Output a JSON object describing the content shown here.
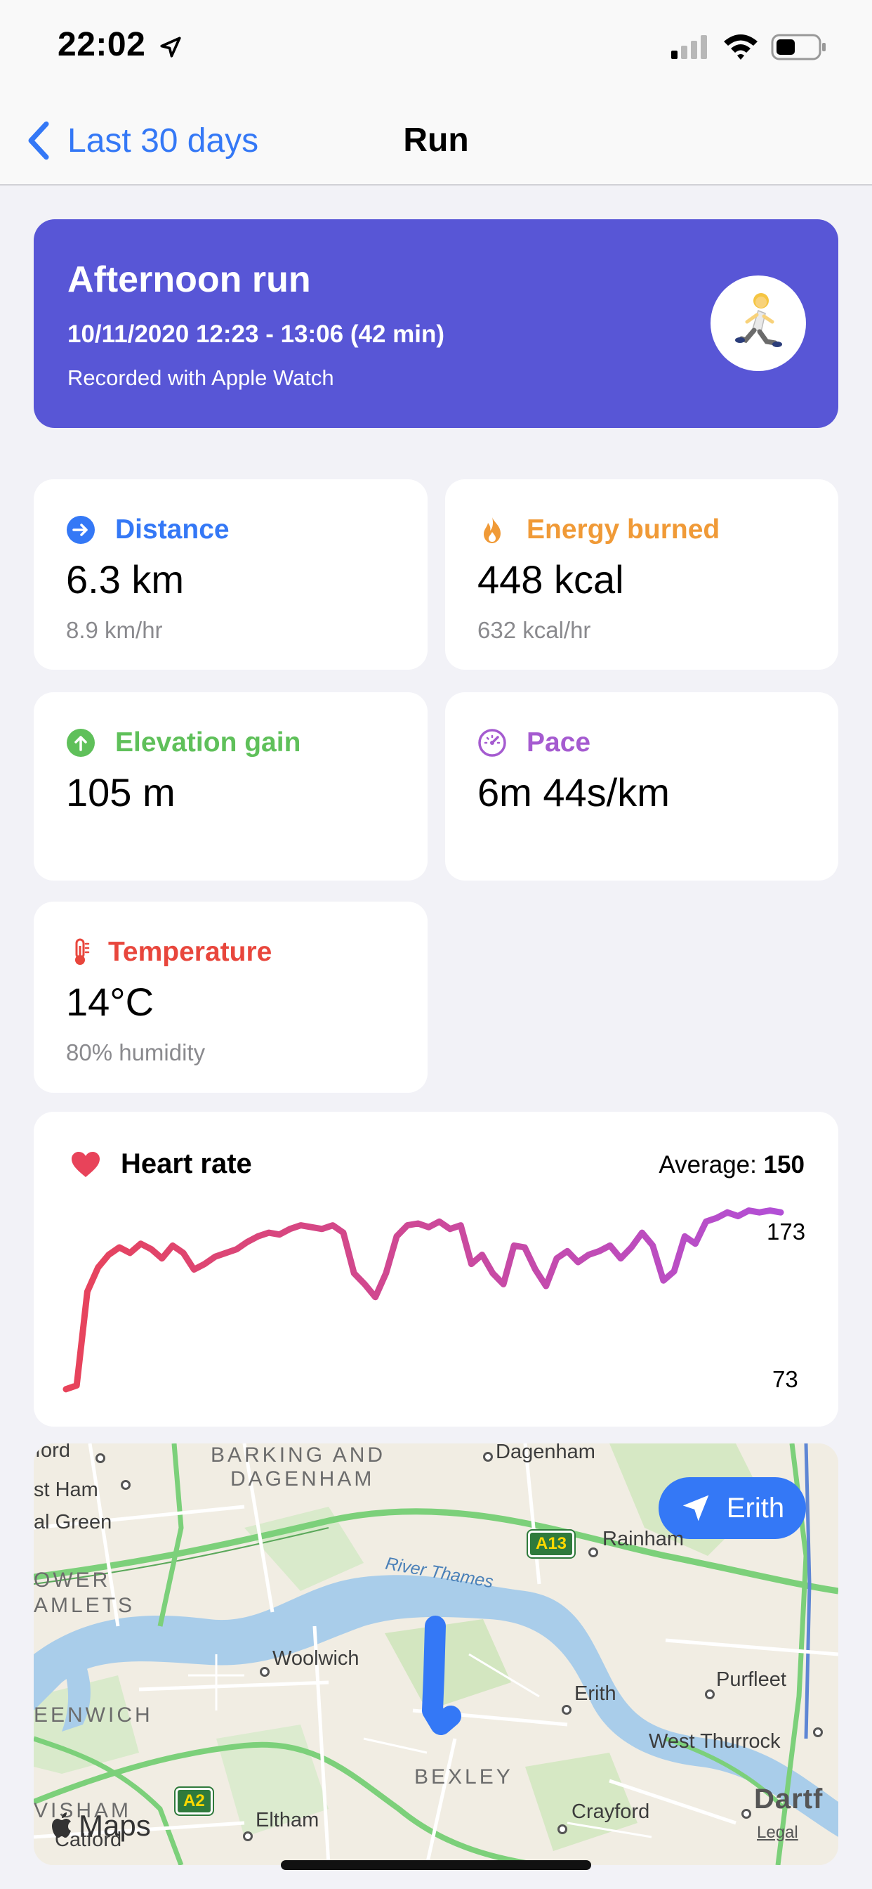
{
  "status_bar": {
    "time": "22:02"
  },
  "nav": {
    "back_label": "Last 30 days",
    "title": "Run"
  },
  "workout": {
    "title": "Afternoon run",
    "time_range": "10/11/2020 12:23 - 13:06 (42 min)",
    "source": "Recorded with Apple Watch",
    "icon": "runner-emoji"
  },
  "metrics": {
    "distance": {
      "label": "Distance",
      "value": "6.3 km",
      "sub": "8.9 km/hr",
      "color": "#3478f6",
      "icon": "arrow-right-circle-icon"
    },
    "energy": {
      "label": "Energy burned",
      "value": "448 kcal",
      "sub": "632 kcal/hr",
      "color": "#f09a37",
      "icon": "flame-icon"
    },
    "elevation": {
      "label": "Elevation gain",
      "value": "105 m",
      "color": "#5fc05a",
      "icon": "arrow-up-circle-icon"
    },
    "pace": {
      "label": "Pace",
      "value": "6m 44s/km",
      "color": "#a55bd0",
      "icon": "speedometer-icon"
    },
    "temperature": {
      "label": "Temperature",
      "value": "14°C",
      "sub": "80% humidity",
      "color": "#e8463c",
      "icon": "thermometer-icon"
    }
  },
  "heart_rate": {
    "title": "Heart rate",
    "average_label": "Average:",
    "average_value": "150",
    "max_label": "173",
    "min_label": "73",
    "colors": {
      "start": "#e8435a",
      "end": "#b24fd6"
    }
  },
  "map": {
    "location_button": "Erith",
    "labels": {
      "ilford": "ford",
      "east_ham": "st Ham",
      "plaistow_green": "al Green",
      "barking": "BARKING AND",
      "dagenham_area": "DAGENHAM",
      "dagenham": "Dagenham",
      "rainham": "Rainham",
      "tower": "OWER",
      "hamlets": "AMLETS",
      "river": "River Thames",
      "woolwich": "Woolwich",
      "erith": "Erith",
      "purfleet": "Purfleet",
      "greenwich": "EENWICH",
      "west_thurrock": "West Thurrock",
      "bexley": "BEXLEY",
      "lewisham": "VISHAM",
      "catford": "Catford",
      "eltham": "Eltham",
      "crayford": "Crayford",
      "dartford": "Dartf"
    },
    "road_signs": {
      "a13": "A13",
      "a2": "A2"
    },
    "attribution": "Maps",
    "legal": "Legal"
  },
  "chart_data": {
    "type": "line",
    "title": "Heart rate",
    "ylim": [
      73,
      173
    ],
    "series": [
      {
        "values": [
          75,
          77,
          128,
          141,
          148,
          152,
          149,
          154,
          151,
          146,
          153,
          149,
          140,
          143,
          147,
          149,
          151,
          155,
          158,
          160,
          159,
          162,
          164,
          163,
          162,
          164,
          160,
          138,
          132,
          125,
          138,
          158,
          164,
          165,
          163,
          166,
          162,
          164,
          143,
          148,
          138,
          132,
          153,
          152,
          140,
          131,
          146,
          150,
          144,
          148,
          150,
          153,
          146,
          152,
          160,
          153,
          134,
          139,
          158,
          154,
          166,
          168,
          171,
          169,
          172,
          171,
          172,
          171
        ]
      }
    ]
  }
}
